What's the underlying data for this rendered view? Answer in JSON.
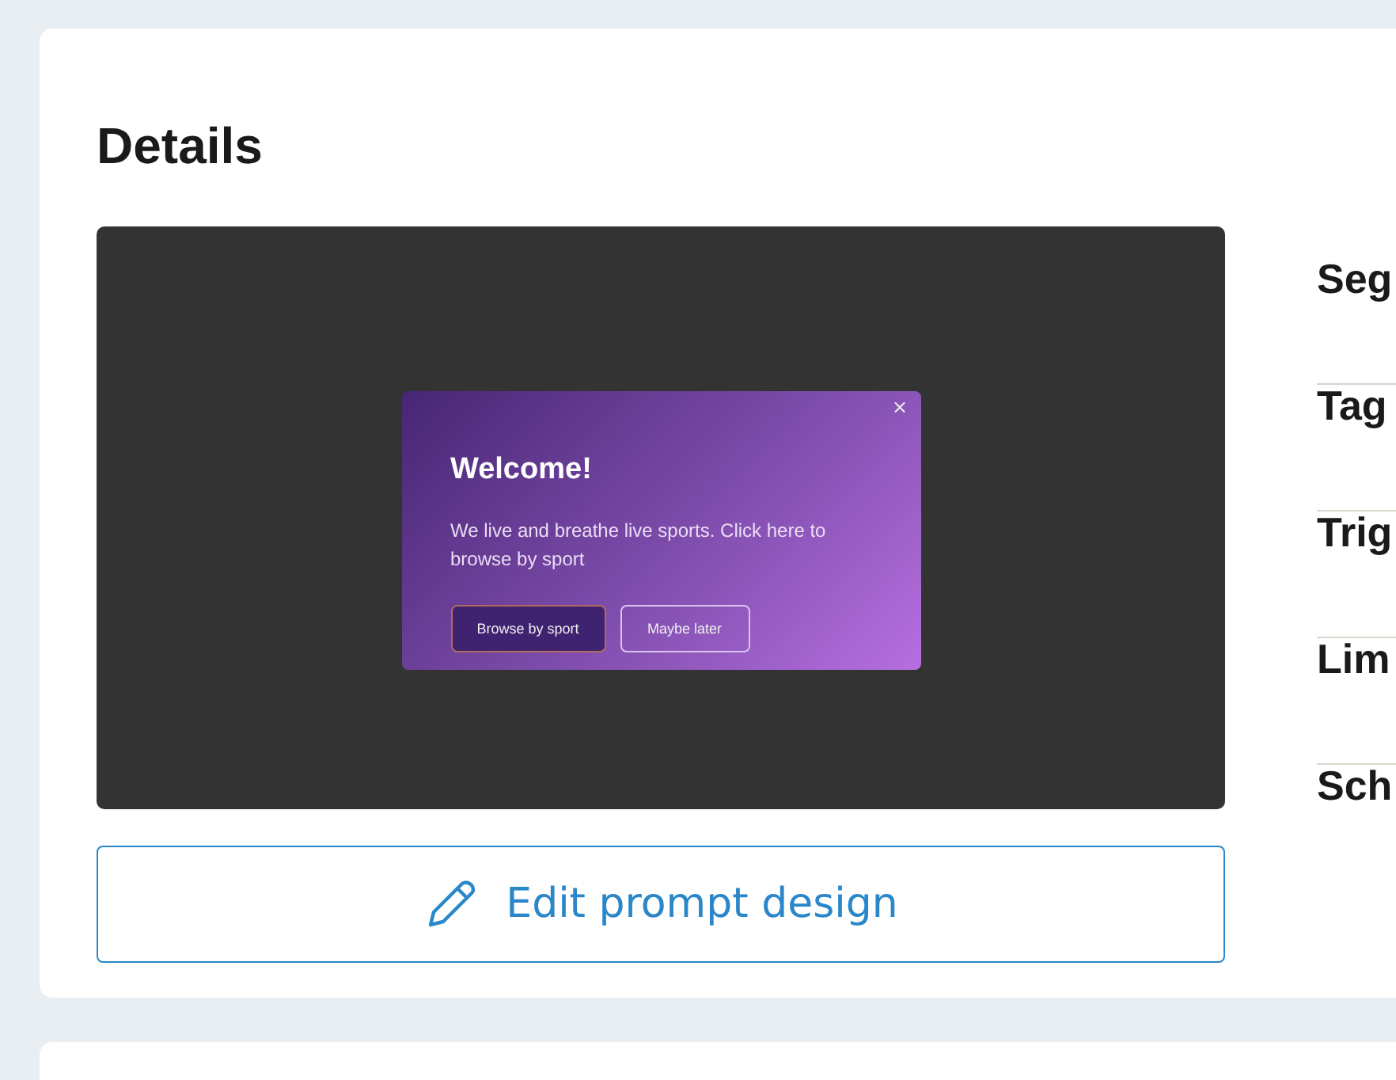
{
  "card": {
    "title": "Details",
    "preview": {
      "prompt": {
        "close": "×",
        "heading": "Welcome!",
        "body": "We live and breathe live sports. Click here to browse by sport",
        "buttons": [
          {
            "label": "Browse by sport",
            "kind": "primary"
          },
          {
            "label": "Maybe later",
            "kind": "secondary"
          }
        ]
      }
    },
    "edit_button": {
      "label": "Edit prompt design"
    },
    "sections": [
      "Seg",
      "Tag",
      "Trig",
      "Lim",
      "Sch"
    ]
  }
}
